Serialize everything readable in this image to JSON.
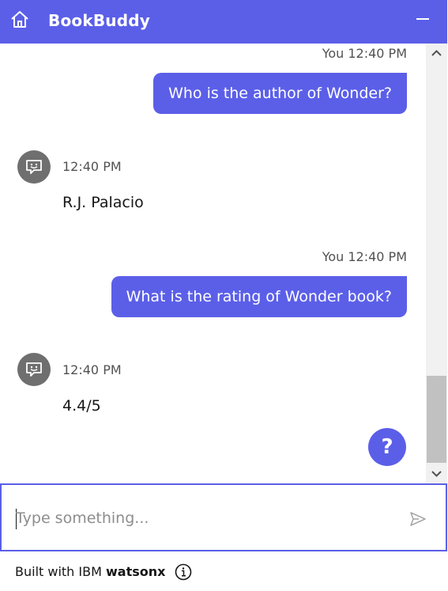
{
  "header": {
    "title": "BookBuddy",
    "home_icon": "home-icon",
    "minimize_icon": "minimize-icon",
    "background": "#5b5fe8"
  },
  "messages": [
    {
      "sender": "user",
      "meta": "You 12:40 PM",
      "text": "Who is the author of Wonder?"
    },
    {
      "sender": "bot",
      "time": "12:40 PM",
      "text": "R.J. Palacio",
      "avatar_icon": "chat-bot-icon"
    },
    {
      "sender": "user",
      "meta": "You 12:40 PM",
      "text": "What is the rating of Wonder book?"
    },
    {
      "sender": "bot",
      "time": "12:40 PM",
      "text": "4.4/5",
      "avatar_icon": "chat-bot-icon"
    }
  ],
  "help_button": {
    "label": "?"
  },
  "input": {
    "placeholder": "Type something...",
    "value": "",
    "send_icon": "send-icon"
  },
  "footer": {
    "prefix": "Built with IBM ",
    "brand": "watsonx",
    "info_icon": "info-icon"
  },
  "colors": {
    "accent": "#5b5fe8",
    "bot_avatar": "#6f6f6f",
    "scroll_thumb": "#c1c1c1"
  }
}
